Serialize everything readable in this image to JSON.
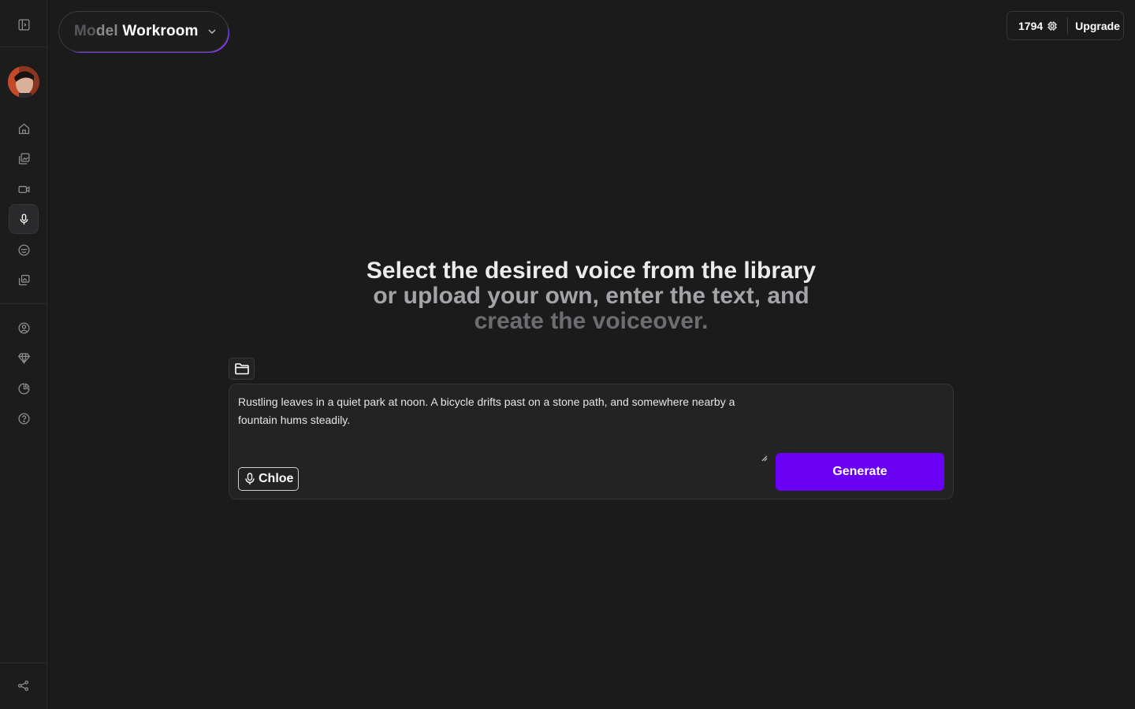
{
  "app": {
    "model_selector": {
      "prefix_dim": "Mo",
      "prefix_mid": "del",
      "name": "Workroom"
    },
    "credits": {
      "count": "1794",
      "upgrade_label": "Upgrade"
    }
  },
  "sidebar": {
    "items": [
      {
        "name": "toggle-sidebar",
        "icon": "sidebar-toggle-icon"
      },
      {
        "name": "home",
        "icon": "home-icon"
      },
      {
        "name": "images",
        "icon": "image-gallery-icon"
      },
      {
        "name": "video",
        "icon": "video-camera-icon"
      },
      {
        "name": "voice",
        "icon": "microphone-icon",
        "active": true
      },
      {
        "name": "characters",
        "icon": "face-icon"
      },
      {
        "name": "library",
        "icon": "stacked-images-icon"
      },
      {
        "name": "account",
        "icon": "user-circle-icon"
      },
      {
        "name": "pricing",
        "icon": "diamond-icon"
      },
      {
        "name": "usage",
        "icon": "pie-chart-icon"
      },
      {
        "name": "help",
        "icon": "help-circle-icon"
      },
      {
        "name": "share",
        "icon": "share-icon"
      }
    ]
  },
  "main": {
    "headline": {
      "line1": "Select the desired voice from the library",
      "line2": "or upload your own, enter the text, and",
      "line3": "create the voiceover."
    },
    "prompt_text": "Rustling leaves in a quiet park at noon. A bicycle drifts past on a stone path, and somewhere nearby a fountain hums steadily.",
    "voice_label": "Chloe",
    "generate_label": "Generate"
  },
  "colors": {
    "background": "#1b1b1c",
    "accent": "#6a00f4"
  }
}
